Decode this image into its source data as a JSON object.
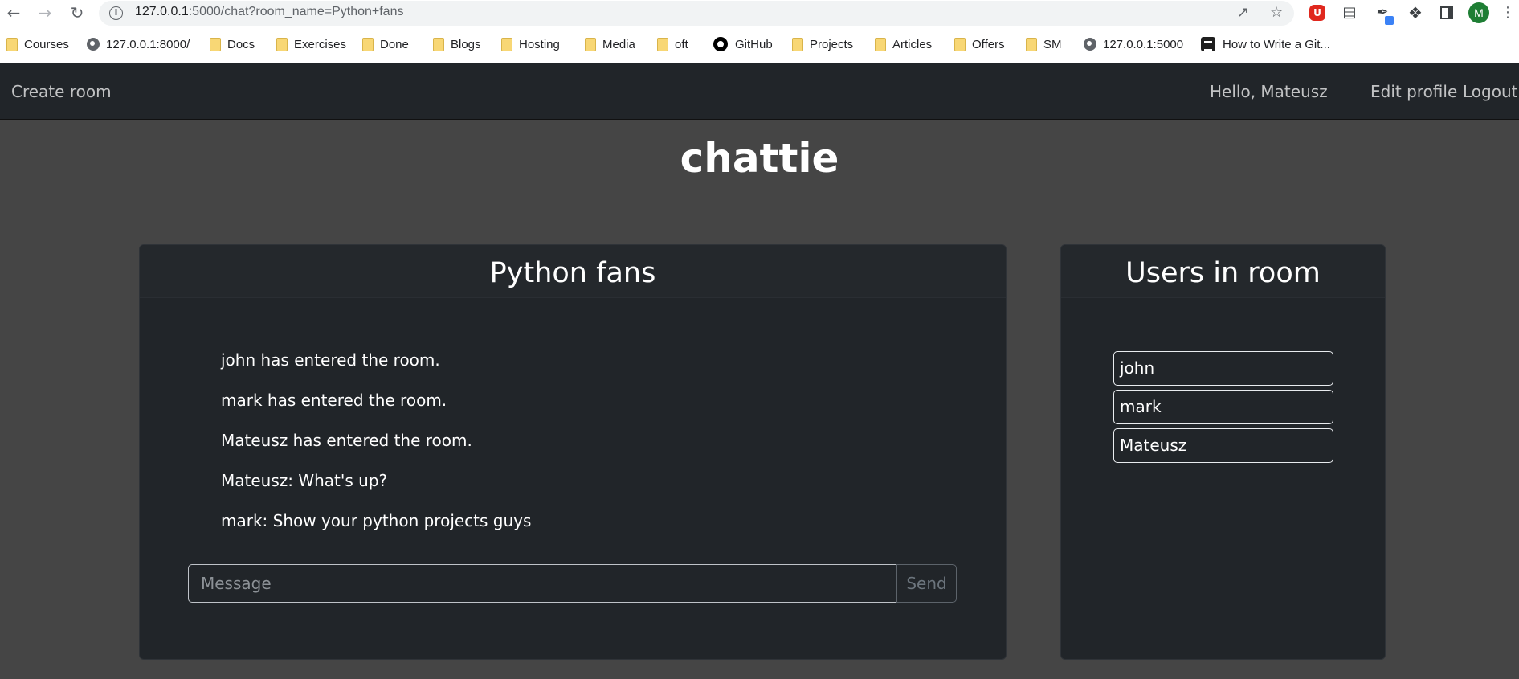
{
  "browser": {
    "url_host": "127.0.0.1",
    "url_rest": ":5000/chat?room_name=Python+fans",
    "profile_initial": "M",
    "adblock_label": "U",
    "bookmarks": [
      {
        "label": "Courses",
        "icon": "folder-icon"
      },
      {
        "label": "127.0.0.1:8000/",
        "icon": "globe-icon"
      },
      {
        "label": "Docs",
        "icon": "folder-icon"
      },
      {
        "label": "Exercises",
        "icon": "folder-icon"
      },
      {
        "label": "Done",
        "icon": "folder-icon"
      },
      {
        "label": "Blogs",
        "icon": "folder-icon"
      },
      {
        "label": "Hosting",
        "icon": "folder-icon"
      },
      {
        "label": "Media",
        "icon": "folder-icon"
      },
      {
        "label": "oft",
        "icon": "folder-icon"
      },
      {
        "label": "GitHub",
        "icon": "github-icon"
      },
      {
        "label": "Projects",
        "icon": "folder-icon"
      },
      {
        "label": "Articles",
        "icon": "folder-icon"
      },
      {
        "label": "Offers",
        "icon": "folder-icon"
      },
      {
        "label": "SM",
        "icon": "folder-icon"
      },
      {
        "label": "127.0.0.1:5000",
        "icon": "globe-icon"
      },
      {
        "label": "How to Write a Git...",
        "icon": "doc-icon"
      }
    ]
  },
  "navbar": {
    "create_room": "Create room",
    "greeting": "Hello, Mateusz",
    "edit_profile": "Edit profile",
    "logout": "Logout"
  },
  "app_title": "chattie",
  "chat": {
    "room_name": "Python fans",
    "messages": [
      "john has entered the room.",
      "mark has entered the room.",
      "Mateusz has entered the room.",
      "Mateusz: What's up?",
      "mark: Show your python projects guys"
    ],
    "input_placeholder": "Message",
    "input_value": "",
    "send_label": "Send"
  },
  "users": {
    "title": "Users in room",
    "list": [
      "john",
      "mark",
      "Mateusz"
    ]
  }
}
